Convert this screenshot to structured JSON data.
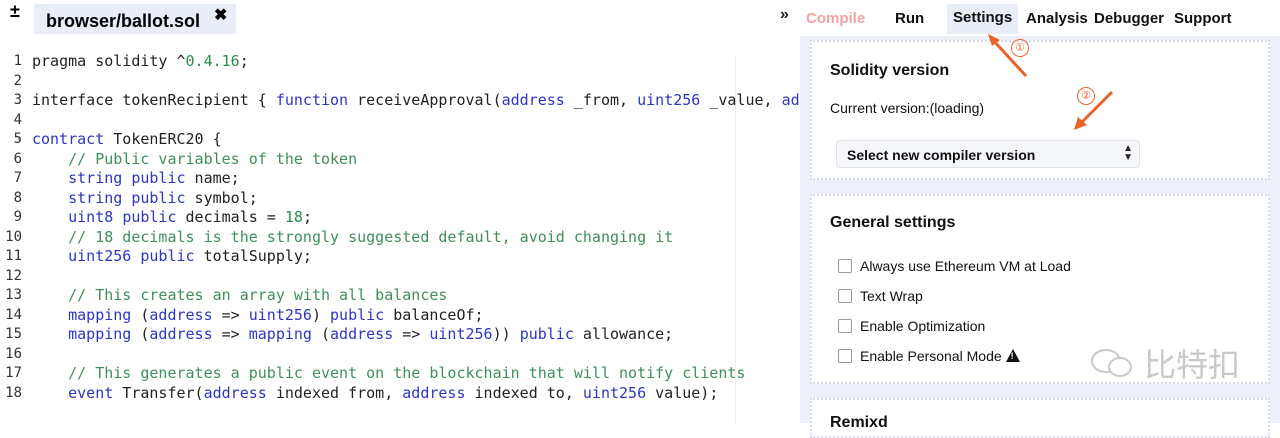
{
  "toolbar": {
    "add_remove_symbol": "±",
    "file_tab": "browser/ballot.sol",
    "close_symbol": "✖",
    "expand_symbol": "»"
  },
  "menu": {
    "compile": "Compile",
    "run": "Run",
    "settings": "Settings",
    "analysis": "Analysis",
    "debugger": "Debugger",
    "support": "Support"
  },
  "editor": {
    "line_numbers": [
      "1",
      "2",
      "3",
      "4",
      "5",
      "6",
      "7",
      "8",
      "9",
      "10",
      "11",
      "12",
      "13",
      "14",
      "15",
      "16",
      "17",
      "18"
    ]
  },
  "solidity_card": {
    "title": "Solidity version",
    "current_version": "Current version:(loading)",
    "select_label": "Select new compiler version"
  },
  "general_card": {
    "title": "General settings",
    "options": [
      "Always use Ethereum VM at Load",
      "Text Wrap",
      "Enable Optimization",
      "Enable Personal Mode"
    ]
  },
  "remixd_card": {
    "title": "Remixd"
  },
  "annotations": {
    "marker_1": "①",
    "marker_2": "②",
    "color": "#e8622a"
  },
  "watermark": {
    "text": "比特扣"
  },
  "colors": {
    "keyword": "#2b36c2",
    "comment": "#3f8f5b",
    "panel_bg": "#edf0f8",
    "active_tab_bg": "#e9edf8",
    "compile_disabled": "#f2a2a2"
  }
}
